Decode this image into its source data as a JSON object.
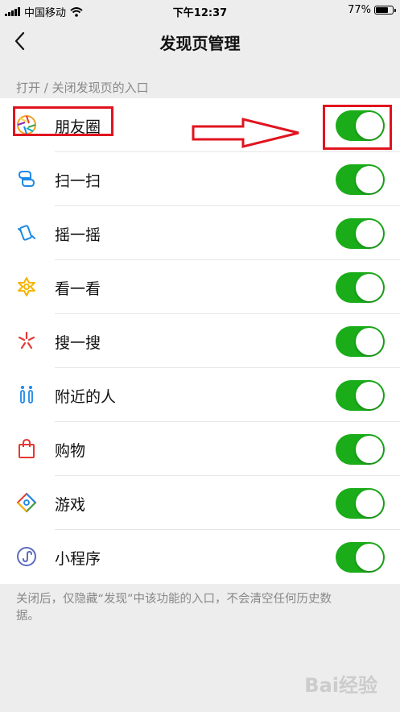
{
  "status_bar": {
    "carrier": "中国移动",
    "time": "下午12:37",
    "battery_percent": "77%",
    "battery_level": 0.77
  },
  "nav": {
    "title": "发现页管理",
    "back_icon": "chevron-left-icon"
  },
  "section_header": "打开 / 关闭发现页的入口",
  "items": [
    {
      "label": "朋友圈",
      "icon": "moments-aperture-icon",
      "enabled": true
    },
    {
      "label": "扫一扫",
      "icon": "scan-icon",
      "enabled": true
    },
    {
      "label": "摇一摇",
      "icon": "shake-phone-icon",
      "enabled": true
    },
    {
      "label": "看一看",
      "icon": "top-stories-icon",
      "enabled": true
    },
    {
      "label": "搜一搜",
      "icon": "search-sparkle-icon",
      "enabled": true
    },
    {
      "label": "附近的人",
      "icon": "people-nearby-icon",
      "enabled": true
    },
    {
      "label": "购物",
      "icon": "shopping-bag-icon",
      "enabled": true
    },
    {
      "label": "游戏",
      "icon": "games-icon",
      "enabled": true
    },
    {
      "label": "小程序",
      "icon": "mini-programs-icon",
      "enabled": true
    }
  ],
  "footer_note": "关闭后，仅隐藏“发现”中该功能的入口，不会清空任何历史数据。",
  "watermark": "Bai经验",
  "colors": {
    "toggle_on": "#1aad19",
    "annotation_red": "#e0141f",
    "background": "#ededed"
  }
}
